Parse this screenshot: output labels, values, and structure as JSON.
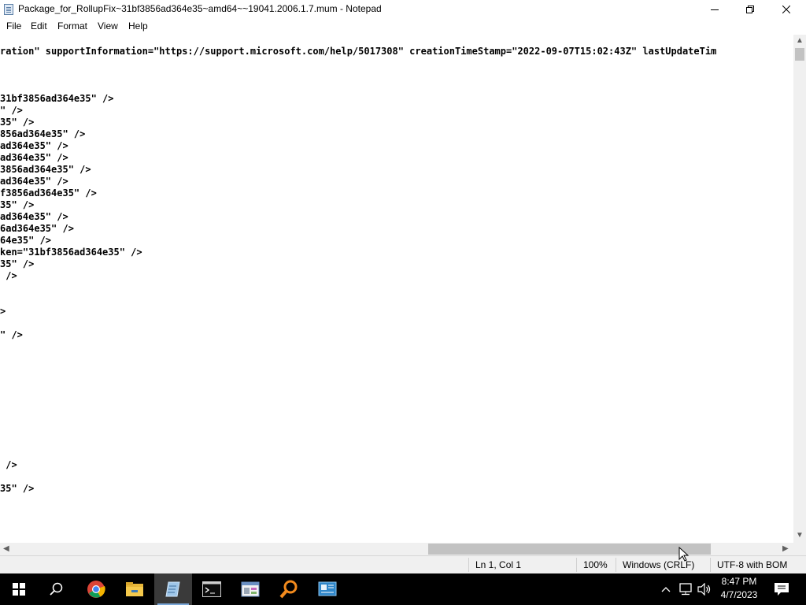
{
  "window": {
    "title": "Package_for_RollupFix~31bf3856ad364e35~amd64~~19041.2006.1.7.mum - Notepad"
  },
  "menu": [
    "File",
    "Edit",
    "Format",
    "View",
    "Help"
  ],
  "editor": {
    "lines": [
      "ration\" supportInformation=\"https://support.microsoft.com/help/5017308\" creationTimeStamp=\"2022-09-07T15:02:43Z\" lastUpdateTim",
      "",
      "",
      "",
      "31bf3856ad364e35\" />",
      "\" />",
      "35\" />",
      "856ad364e35\" />",
      "ad364e35\" />",
      "ad364e35\" />",
      "3856ad364e35\" />",
      "ad364e35\" />",
      "f3856ad364e35\" />",
      "35\" />",
      "ad364e35\" />",
      "6ad364e35\" />",
      "64e35\" />",
      "ken=\"31bf3856ad364e35\" />",
      "35\" />",
      " />",
      "",
      "",
      ">",
      "",
      "\" />",
      "",
      "",
      "",
      "",
      "",
      "",
      "",
      "",
      "",
      "",
      " />",
      "",
      "35\" />"
    ]
  },
  "status": {
    "position": "Ln 1, Col 1",
    "zoom": "100%",
    "line_endings": "Windows (CRLF)",
    "encoding": "UTF-8 with BOM"
  },
  "clock": {
    "time": "8:47 PM",
    "date": "4/7/2023"
  }
}
